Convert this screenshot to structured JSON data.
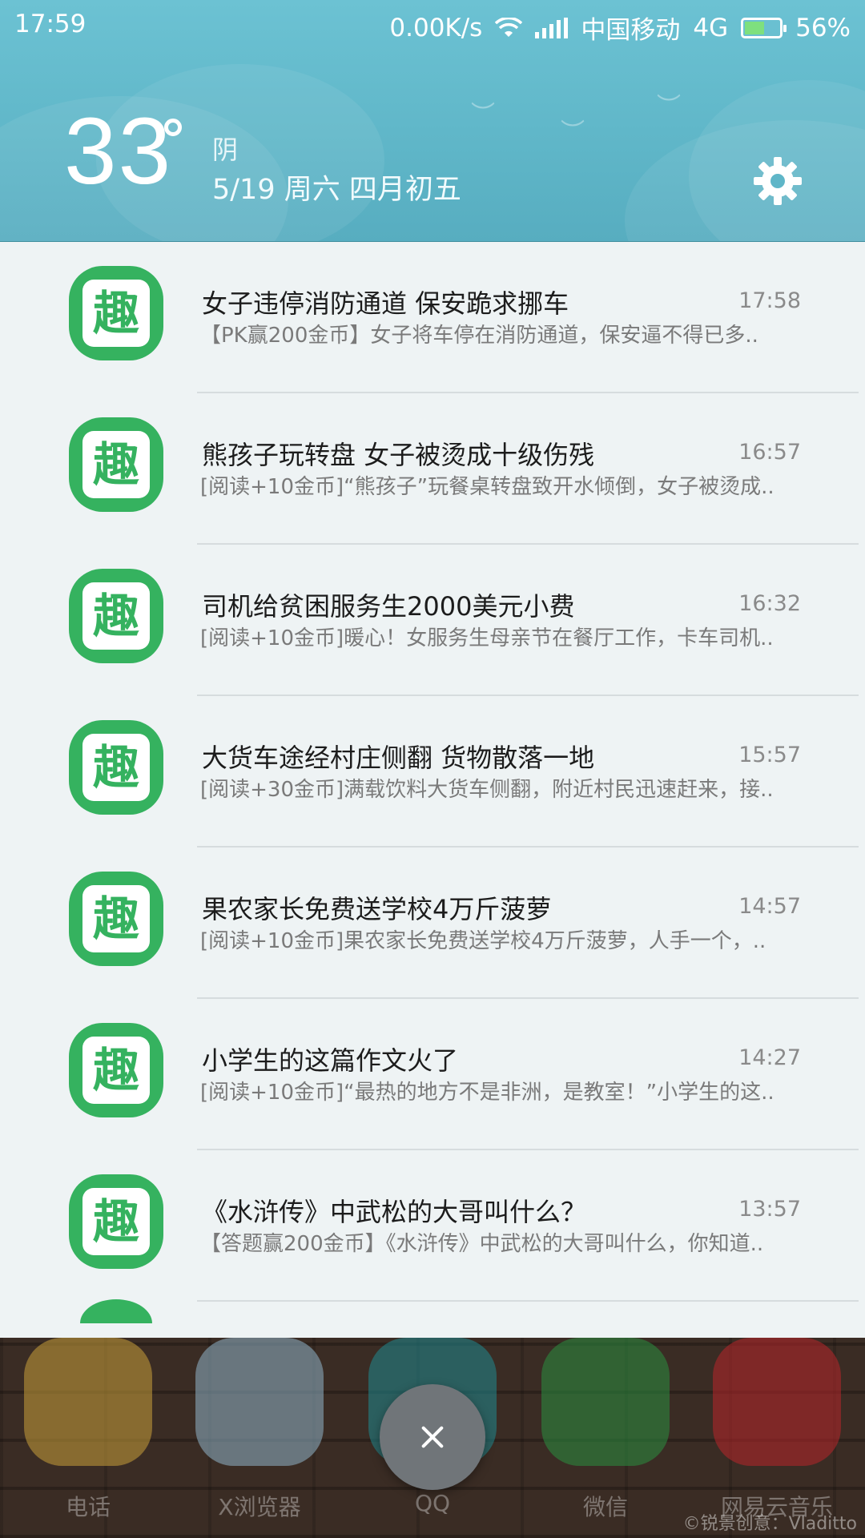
{
  "status_bar": {
    "time": "17:59",
    "speed": "0.00K/s",
    "carrier": "中国移动",
    "network": "4G",
    "battery": "56%",
    "battery_level": 0.56
  },
  "weather": {
    "temperature": "33",
    "condition": "阴",
    "date": "5/19 周六 四月初五"
  },
  "app_icon_char": "趣",
  "notifications": [
    {
      "title": "女子违停消防通道 保安跪求挪车",
      "body": "【PK赢200金币】女子将车停在消防通道，保安逼不得已多..",
      "time": "17:58"
    },
    {
      "title": "熊孩子玩转盘 女子被烫成十级伤残",
      "body": "[阅读+10金币]“熊孩子”玩餐桌转盘致开水倾倒，女子被烫成..",
      "time": "16:57"
    },
    {
      "title": "司机给贫困服务生2000美元小费",
      "body": "[阅读+10金币]暖心！女服务生母亲节在餐厅工作，卡车司机..",
      "time": "16:32"
    },
    {
      "title": "大货车途经村庄侧翻 货物散落一地",
      "body": "[阅读+30金币]满载饮料大货车侧翻，附近村民迅速赶来，接..",
      "time": "15:57"
    },
    {
      "title": "果农家长免费送学校4万斤菠萝",
      "body": "[阅读+10金币]果农家长免费送学校4万斤菠萝，人手一个，..",
      "time": "14:57"
    },
    {
      "title": "小学生的这篇作文火了",
      "body": "[阅读+10金币]“最热的地方不是非洲，是教室！”小学生的这..",
      "time": "14:27"
    },
    {
      "title": "《水浒传》中武松的大哥叫什么？",
      "body": "【答题赢200金币】《水浒传》中武松的大哥叫什么，你知道..",
      "time": "13:57"
    }
  ],
  "dock": {
    "apps": [
      {
        "label": "电话",
        "icon": "phone-icon",
        "color": "#c9a13a"
      },
      {
        "label": "X浏览器",
        "icon": "x-browser-icon",
        "color": "#8fb5c9"
      },
      {
        "label": "QQ",
        "icon": "qq-icon",
        "color": "#1f8a8f"
      },
      {
        "label": "微信",
        "icon": "wechat-icon",
        "color": "#2a8f3f"
      },
      {
        "label": "网易云音乐",
        "icon": "netease-music-icon",
        "color": "#b8262a"
      }
    ],
    "watermark": "©锐景创意：Vladitto"
  }
}
